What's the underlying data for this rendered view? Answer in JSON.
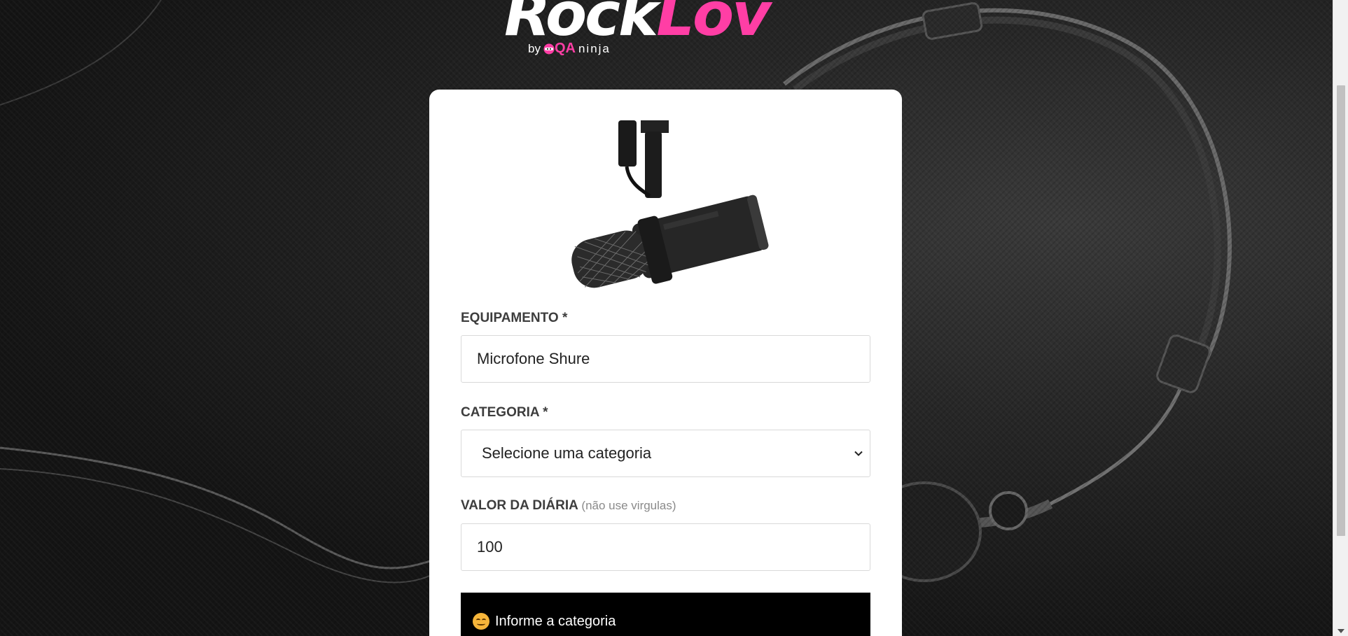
{
  "brand": {
    "word_part1": "Rock",
    "word_part2": "Lov",
    "by_label": "by",
    "qa_label": "QA",
    "ninja_label": "ninja",
    "accent_color": "#ff3ea5"
  },
  "form": {
    "product_image_icon": "microphone-image",
    "equipment": {
      "label": "EQUIPAMENTO *",
      "value": "Microfone Shure"
    },
    "category": {
      "label": "CATEGORIA *",
      "selected": "Selecione uma categoria"
    },
    "price": {
      "label": "VALOR DA DIÁRIA",
      "hint": "(não use virgulas)",
      "value": "100"
    },
    "alert": {
      "icon": "smiling-face-icon",
      "message": "Informe a categoria"
    }
  }
}
